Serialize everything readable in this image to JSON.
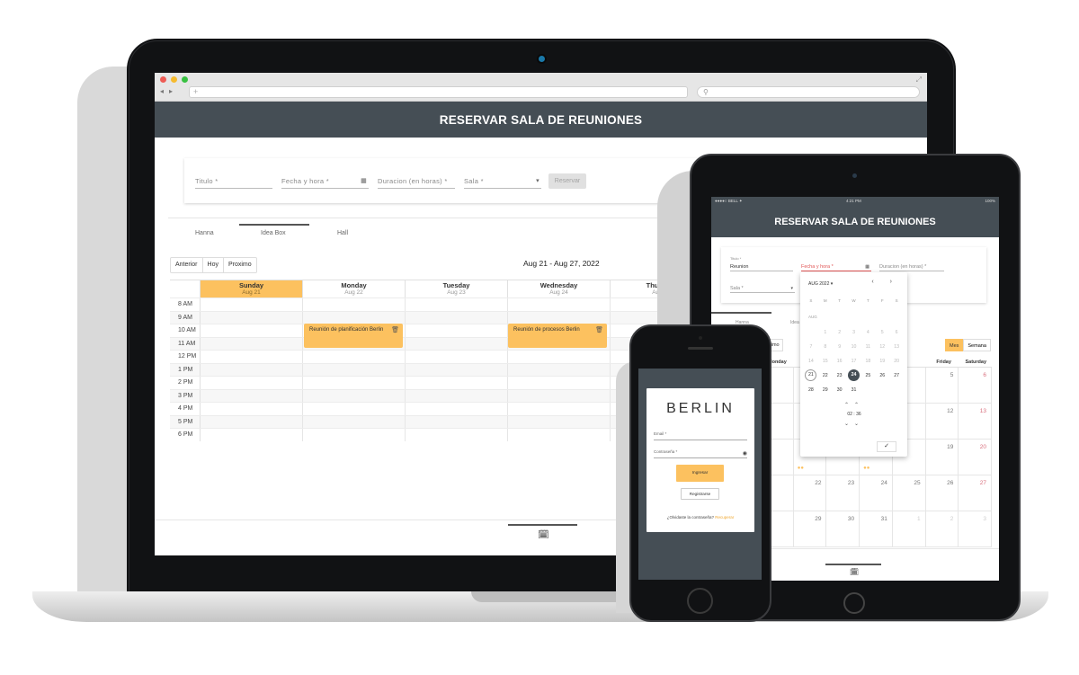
{
  "laptop": {
    "header_title": "RESERVAR SALA DE REUNIONES",
    "form": {
      "titulo_placeholder": "Titulo *",
      "fecha_placeholder": "Fecha y hora *",
      "duracion_placeholder": "Duracion (en horas) *",
      "sala_placeholder": "Sala *",
      "reservar_label": "Reservar"
    },
    "rooms": [
      "Hanna",
      "Idea Box",
      "Hall"
    ],
    "nav": {
      "prev": "Anterior",
      "today": "Hoy",
      "next": "Proximo"
    },
    "date_range": "Aug 21 - Aug 27, 2022",
    "days": [
      {
        "name": "Sunday",
        "date": "Aug 21"
      },
      {
        "name": "Monday",
        "date": "Aug 22"
      },
      {
        "name": "Tuesday",
        "date": "Aug 23"
      },
      {
        "name": "Wednesday",
        "date": "Aug 24"
      },
      {
        "name": "Thursday",
        "date": "Aug 25"
      }
    ],
    "hours": [
      "8 AM",
      "9 AM",
      "10 AM",
      "11 AM",
      "12 PM",
      "1 PM",
      "2 PM",
      "3 PM",
      "4 PM",
      "5 PM",
      "6 PM"
    ],
    "events": [
      {
        "title": "Reunión de planificación Berlin",
        "day": "Monday",
        "start": "10 AM",
        "end": "11 AM"
      },
      {
        "title": "Reunión de procesos Berlin",
        "day": "Wednesday",
        "start": "10 AM",
        "end": "11 AM"
      }
    ]
  },
  "tablet": {
    "status_left": "●●●●○ BELL ✦",
    "status_time": "4:21 PM",
    "status_right": "100%",
    "header_title": "RESERVAR SALA DE REUNIONES",
    "titulo_label": "Titulo *",
    "titulo_value": "Reunion",
    "fecha_placeholder": "Fecha y hora *",
    "duracion_placeholder": "Duracion (en horas) *",
    "sala_placeholder": "Sala *",
    "tabs": [
      "Hanna",
      "Idea"
    ],
    "hoy_label": "ximo",
    "view_toggle": {
      "month": "Mes",
      "week": "Semana"
    },
    "weekday_headers": [
      "Friday",
      "Saturday"
    ],
    "month_rows": [
      [
        "",
        "",
        "",
        "",
        "",
        "5",
        "6"
      ],
      [
        "",
        "8",
        "",
        "",
        "",
        "12",
        "13"
      ],
      [
        "",
        "15",
        "",
        "",
        "",
        "19",
        "20"
      ],
      [
        "",
        "22",
        "23",
        "24",
        "25",
        "26",
        "27"
      ],
      [
        "",
        "29",
        "30",
        "31",
        "1",
        "2",
        "3"
      ]
    ],
    "picker": {
      "month_label": "AUG 2022 ▾",
      "weekdays": [
        "S",
        "M",
        "T",
        "W",
        "T",
        "F",
        "S"
      ],
      "section_label": "AUG",
      "weeks": [
        [
          "",
          "1",
          "2",
          "3",
          "4",
          "5",
          "6"
        ],
        [
          "7",
          "8",
          "9",
          "10",
          "11",
          "12",
          "13"
        ],
        [
          "14",
          "15",
          "16",
          "17",
          "18",
          "19",
          "20"
        ],
        [
          "21",
          "22",
          "23",
          "24",
          "25",
          "26",
          "27"
        ],
        [
          "28",
          "29",
          "30",
          "31",
          "",
          "",
          ""
        ]
      ],
      "current_day": "21",
      "selected_day": "24",
      "hour": "02",
      "minute": "36",
      "confirm": "✓"
    }
  },
  "phone": {
    "brand": "BERLIN",
    "email_placeholder": "Email *",
    "password_placeholder": "Contraseña *",
    "login_button": "Ingresar",
    "register_button": "Registrarse",
    "forgot_text": "¿Olvidaste la contraseña?",
    "forgot_link": "Recuperar"
  },
  "colors": {
    "header": "#454e55",
    "accent": "#fcc15f",
    "weekend": "#d9707e"
  }
}
